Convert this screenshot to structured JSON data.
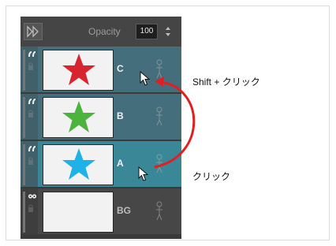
{
  "toolbar": {
    "forward_icon": "double-triangle-right-icon",
    "opacity_label": "Opacity",
    "opacity_value": "100"
  },
  "layers": [
    {
      "name": "C",
      "thumb_color": "#d8242f",
      "state": "selected"
    },
    {
      "name": "B",
      "thumb_color": "#4ab43c",
      "state": "normal"
    },
    {
      "name": "A",
      "thumb_color": "#1eb2e6",
      "state": "active"
    },
    {
      "name": "BG",
      "thumb_color": "",
      "state": "plain"
    }
  ],
  "annotations": {
    "shift_click": "Shift + クリック",
    "click": "クリック",
    "arrow_color": "#e02020"
  }
}
